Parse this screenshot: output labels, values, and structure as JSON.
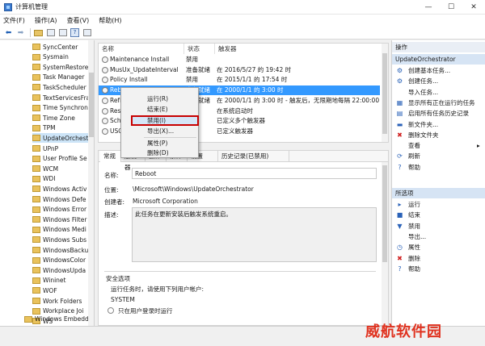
{
  "window": {
    "title": "计算机管理",
    "minimize": "—",
    "maximize": "☐",
    "close": "✕"
  },
  "menubar": [
    "文件(F)",
    "操作(A)",
    "查看(V)",
    "帮助(H)"
  ],
  "tree": {
    "items": [
      "SyncCenter",
      "Sysmain",
      "SystemRestore",
      "Task Manager",
      "TaskScheduler",
      "TextServicesFra",
      "Time Synchron",
      "Time Zone",
      "TPM",
      "UpdateOrchest",
      "UPnP",
      "User Profile Se",
      "WCM",
      "WDI",
      "Windows Activ",
      "Windows Defe",
      "Windows Error",
      "Windows Filter",
      "Windows Medi",
      "Windows Subs",
      "WindowsBacku",
      "WindowsColor",
      "WindowsUpda",
      "Wininet",
      "WOF",
      "Work Folders",
      "Workplace Joi",
      "WS"
    ],
    "selected_index": 9,
    "last": "Windows Embedd"
  },
  "tasklist": {
    "headers": [
      "名称",
      "状态",
      "触发器"
    ],
    "rows": [
      {
        "name": "Maintenance Install",
        "status": "禁用",
        "trigger": ""
      },
      {
        "name": "MusUx_UpdateInterval",
        "status": "准备就绪",
        "trigger": "在 2016/5/27 的 19:42 时"
      },
      {
        "name": "Policy Install",
        "status": "禁用",
        "trigger": "在 2015/1/1 的 17:54 时"
      },
      {
        "name": "Reboot",
        "status": "准备就绪",
        "trigger": "在 2000/1/1 的 3:00 时"
      },
      {
        "name": "Refresh",
        "status": "准备就绪",
        "trigger": "在 2000/1/1 的 3:00 时 - 触发后，无限期地每隔 22:00:00 重"
      },
      {
        "name": "Resume",
        "status": "",
        "trigger": "在系统启动时"
      },
      {
        "name": "Schedule",
        "status": "",
        "trigger": "已定义多个触发器"
      },
      {
        "name": "USO_R",
        "status": "",
        "trigger": "已定义触发器"
      }
    ],
    "selected_index": 3
  },
  "context_menu": {
    "items": [
      "运行(R)",
      "结束(E)",
      "禁用(I)",
      "导出(X)...",
      "属性(P)",
      "删除(D)"
    ],
    "highlighted": "禁用(I)"
  },
  "detail": {
    "tabs": [
      "常规",
      "触发器",
      "操作",
      "条件",
      "设置",
      "历史记录(已禁用)"
    ],
    "name_label": "名称:",
    "name_value": "Reboot",
    "location_label": "位置:",
    "location_value": "\\Microsoft\\Windows\\UpdateOrchestrator",
    "author_label": "创建者:",
    "author_value": "Microsoft Corporation",
    "desc_label": "描述:",
    "desc_value": "此任务在更新安装后触发系统重启。",
    "security_header": "安全选项",
    "run_as_label": "运行任务时，请使用下列用户帐户:",
    "run_as_value": "SYSTEM",
    "radio1": "只在用户登录时运行"
  },
  "actions": {
    "header": "操作",
    "section1": "UpdateOrchestrator",
    "items1": [
      {
        "icon": "create-basic-task-icon",
        "glyph": "⚙",
        "label": "创建基本任务..."
      },
      {
        "icon": "create-task-icon",
        "glyph": "⚙",
        "label": "创建任务..."
      },
      {
        "icon": "import-icon",
        "glyph": "",
        "label": "导入任务..."
      },
      {
        "icon": "running-tasks-icon",
        "glyph": "▦",
        "label": "显示所有正在运行的任务"
      },
      {
        "icon": "history-icon",
        "glyph": "▤",
        "label": "启用所有任务历史记录"
      },
      {
        "icon": "new-folder-icon",
        "glyph": "▬",
        "label": "新文件夹..."
      },
      {
        "icon": "delete-folder-icon",
        "glyph": "✖",
        "label": "删除文件夹"
      },
      {
        "icon": "view-icon",
        "glyph": "",
        "label": "查看",
        "submenu": "▸"
      },
      {
        "icon": "refresh-icon",
        "glyph": "⟳",
        "label": "刷新"
      },
      {
        "icon": "help-icon",
        "glyph": "?",
        "label": "帮助"
      }
    ],
    "section2": "所选项",
    "items2": [
      {
        "icon": "run-icon",
        "glyph": "▸",
        "label": "运行"
      },
      {
        "icon": "end-icon",
        "glyph": "■",
        "label": "结束"
      },
      {
        "icon": "disable-icon",
        "glyph": "▼",
        "label": "禁用"
      },
      {
        "icon": "export-icon",
        "glyph": "",
        "label": "导出..."
      },
      {
        "icon": "properties-icon",
        "glyph": "◷",
        "label": "属性"
      },
      {
        "icon": "delete-icon",
        "glyph": "✖",
        "label": "删除"
      },
      {
        "icon": "help-icon",
        "glyph": "?",
        "label": "帮助"
      }
    ]
  },
  "watermark": "威航软件园"
}
